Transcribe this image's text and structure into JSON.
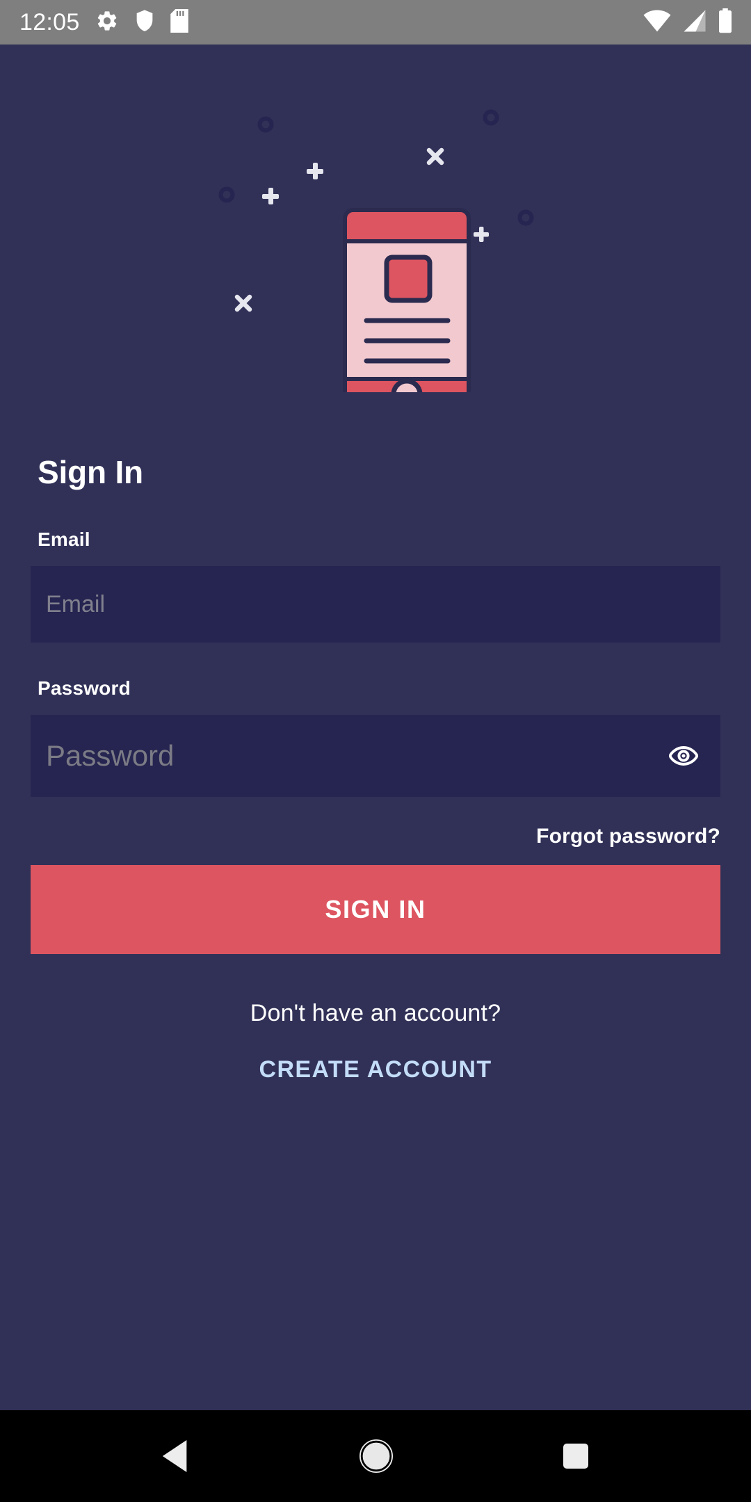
{
  "status_bar": {
    "time": "12:05",
    "left_icons": [
      "gear-icon",
      "shield-icon",
      "sd-card-icon"
    ],
    "right_icons": [
      "wifi-icon",
      "cell-signal-icon",
      "battery-icon"
    ],
    "background_color": "#7f7f7f",
    "foreground_color": "#ffffff"
  },
  "theme": {
    "background": "#313158",
    "field_background": "#262450",
    "accent_red": "#dd5560",
    "link_blue": "#c3dcf7",
    "text_white": "#ffffff",
    "placeholder_gray": "#80808e"
  },
  "illustration": {
    "name": "mobile-phone-illustration",
    "phone_body_color": "#f2c9cf",
    "phone_accent_color": "#dd5560",
    "outline_color": "#2b2a4f",
    "decorations": [
      "circle",
      "circle",
      "plus",
      "plus",
      "cross",
      "cross",
      "circle",
      "circle",
      "plus"
    ]
  },
  "main": {
    "title": "Sign In",
    "email": {
      "label": "Email",
      "placeholder": "Email",
      "value": ""
    },
    "password": {
      "label": "Password",
      "placeholder": "Password",
      "value": "",
      "toggle_icon": "eye-icon"
    },
    "forgot_password_label": "Forgot password?",
    "sign_in_label": "SIGN IN",
    "no_account_text": "Don't have an account?",
    "create_account_label": "CREATE ACCOUNT"
  },
  "nav_bar": {
    "back_label": "back-icon",
    "home_label": "home-icon",
    "recents_label": "recents-icon",
    "background_color": "#000000"
  }
}
